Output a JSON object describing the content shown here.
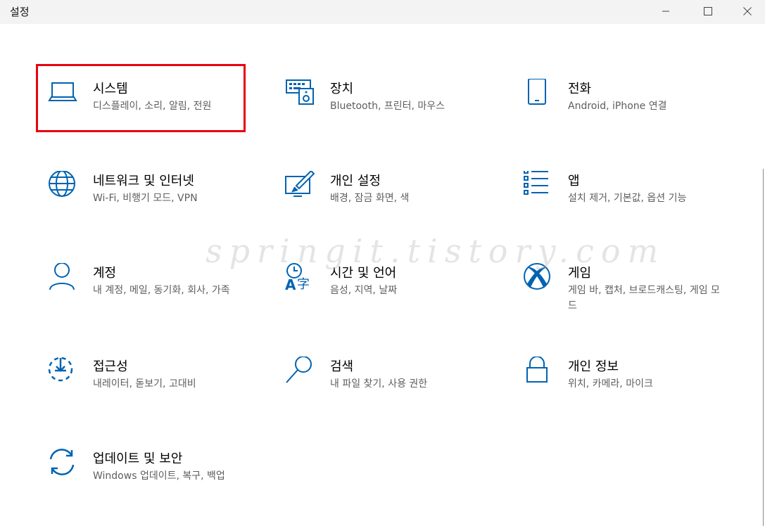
{
  "window": {
    "title": "설정"
  },
  "colors": {
    "accent": "#0063b1",
    "highlight_box": "#e8000f"
  },
  "watermark": "springit.tistory.com",
  "tiles": [
    {
      "name": "시스템",
      "desc": "디스플레이, 소리, 알림, 전원",
      "icon": "laptop-icon"
    },
    {
      "name": "장치",
      "desc": "Bluetooth, 프린터, 마우스",
      "icon": "devices-icon"
    },
    {
      "name": "전화",
      "desc": "Android, iPhone 연결",
      "icon": "phone-icon"
    },
    {
      "name": "네트워크 및 인터넷",
      "desc": "Wi-Fi, 비행기 모드, VPN",
      "icon": "globe-icon"
    },
    {
      "name": "개인 설정",
      "desc": "배경, 잠금 화면, 색",
      "icon": "personalization-icon"
    },
    {
      "name": "앱",
      "desc": "설치 제거, 기본값, 옵션 기능",
      "icon": "apps-list-icon"
    },
    {
      "name": "계정",
      "desc": "내 계정, 메일, 동기화, 회사, 가족",
      "icon": "person-icon"
    },
    {
      "name": "시간 및 언어",
      "desc": "음성, 지역, 날짜",
      "icon": "time-language-icon"
    },
    {
      "name": "게임",
      "desc": "게임 바, 캡처, 브로드캐스팅, 게임 모드",
      "icon": "xbox-icon"
    },
    {
      "name": "접근성",
      "desc": "내레이터, 돋보기, 고대비",
      "icon": "ease-of-access-icon"
    },
    {
      "name": "검색",
      "desc": "내 파일 찾기, 사용 권한",
      "icon": "search-icon"
    },
    {
      "name": "개인 정보",
      "desc": "위치, 카메라, 마이크",
      "icon": "lock-icon"
    },
    {
      "name": "업데이트 및 보안",
      "desc": "Windows 업데이트, 복구, 백업",
      "icon": "update-sync-icon"
    }
  ]
}
